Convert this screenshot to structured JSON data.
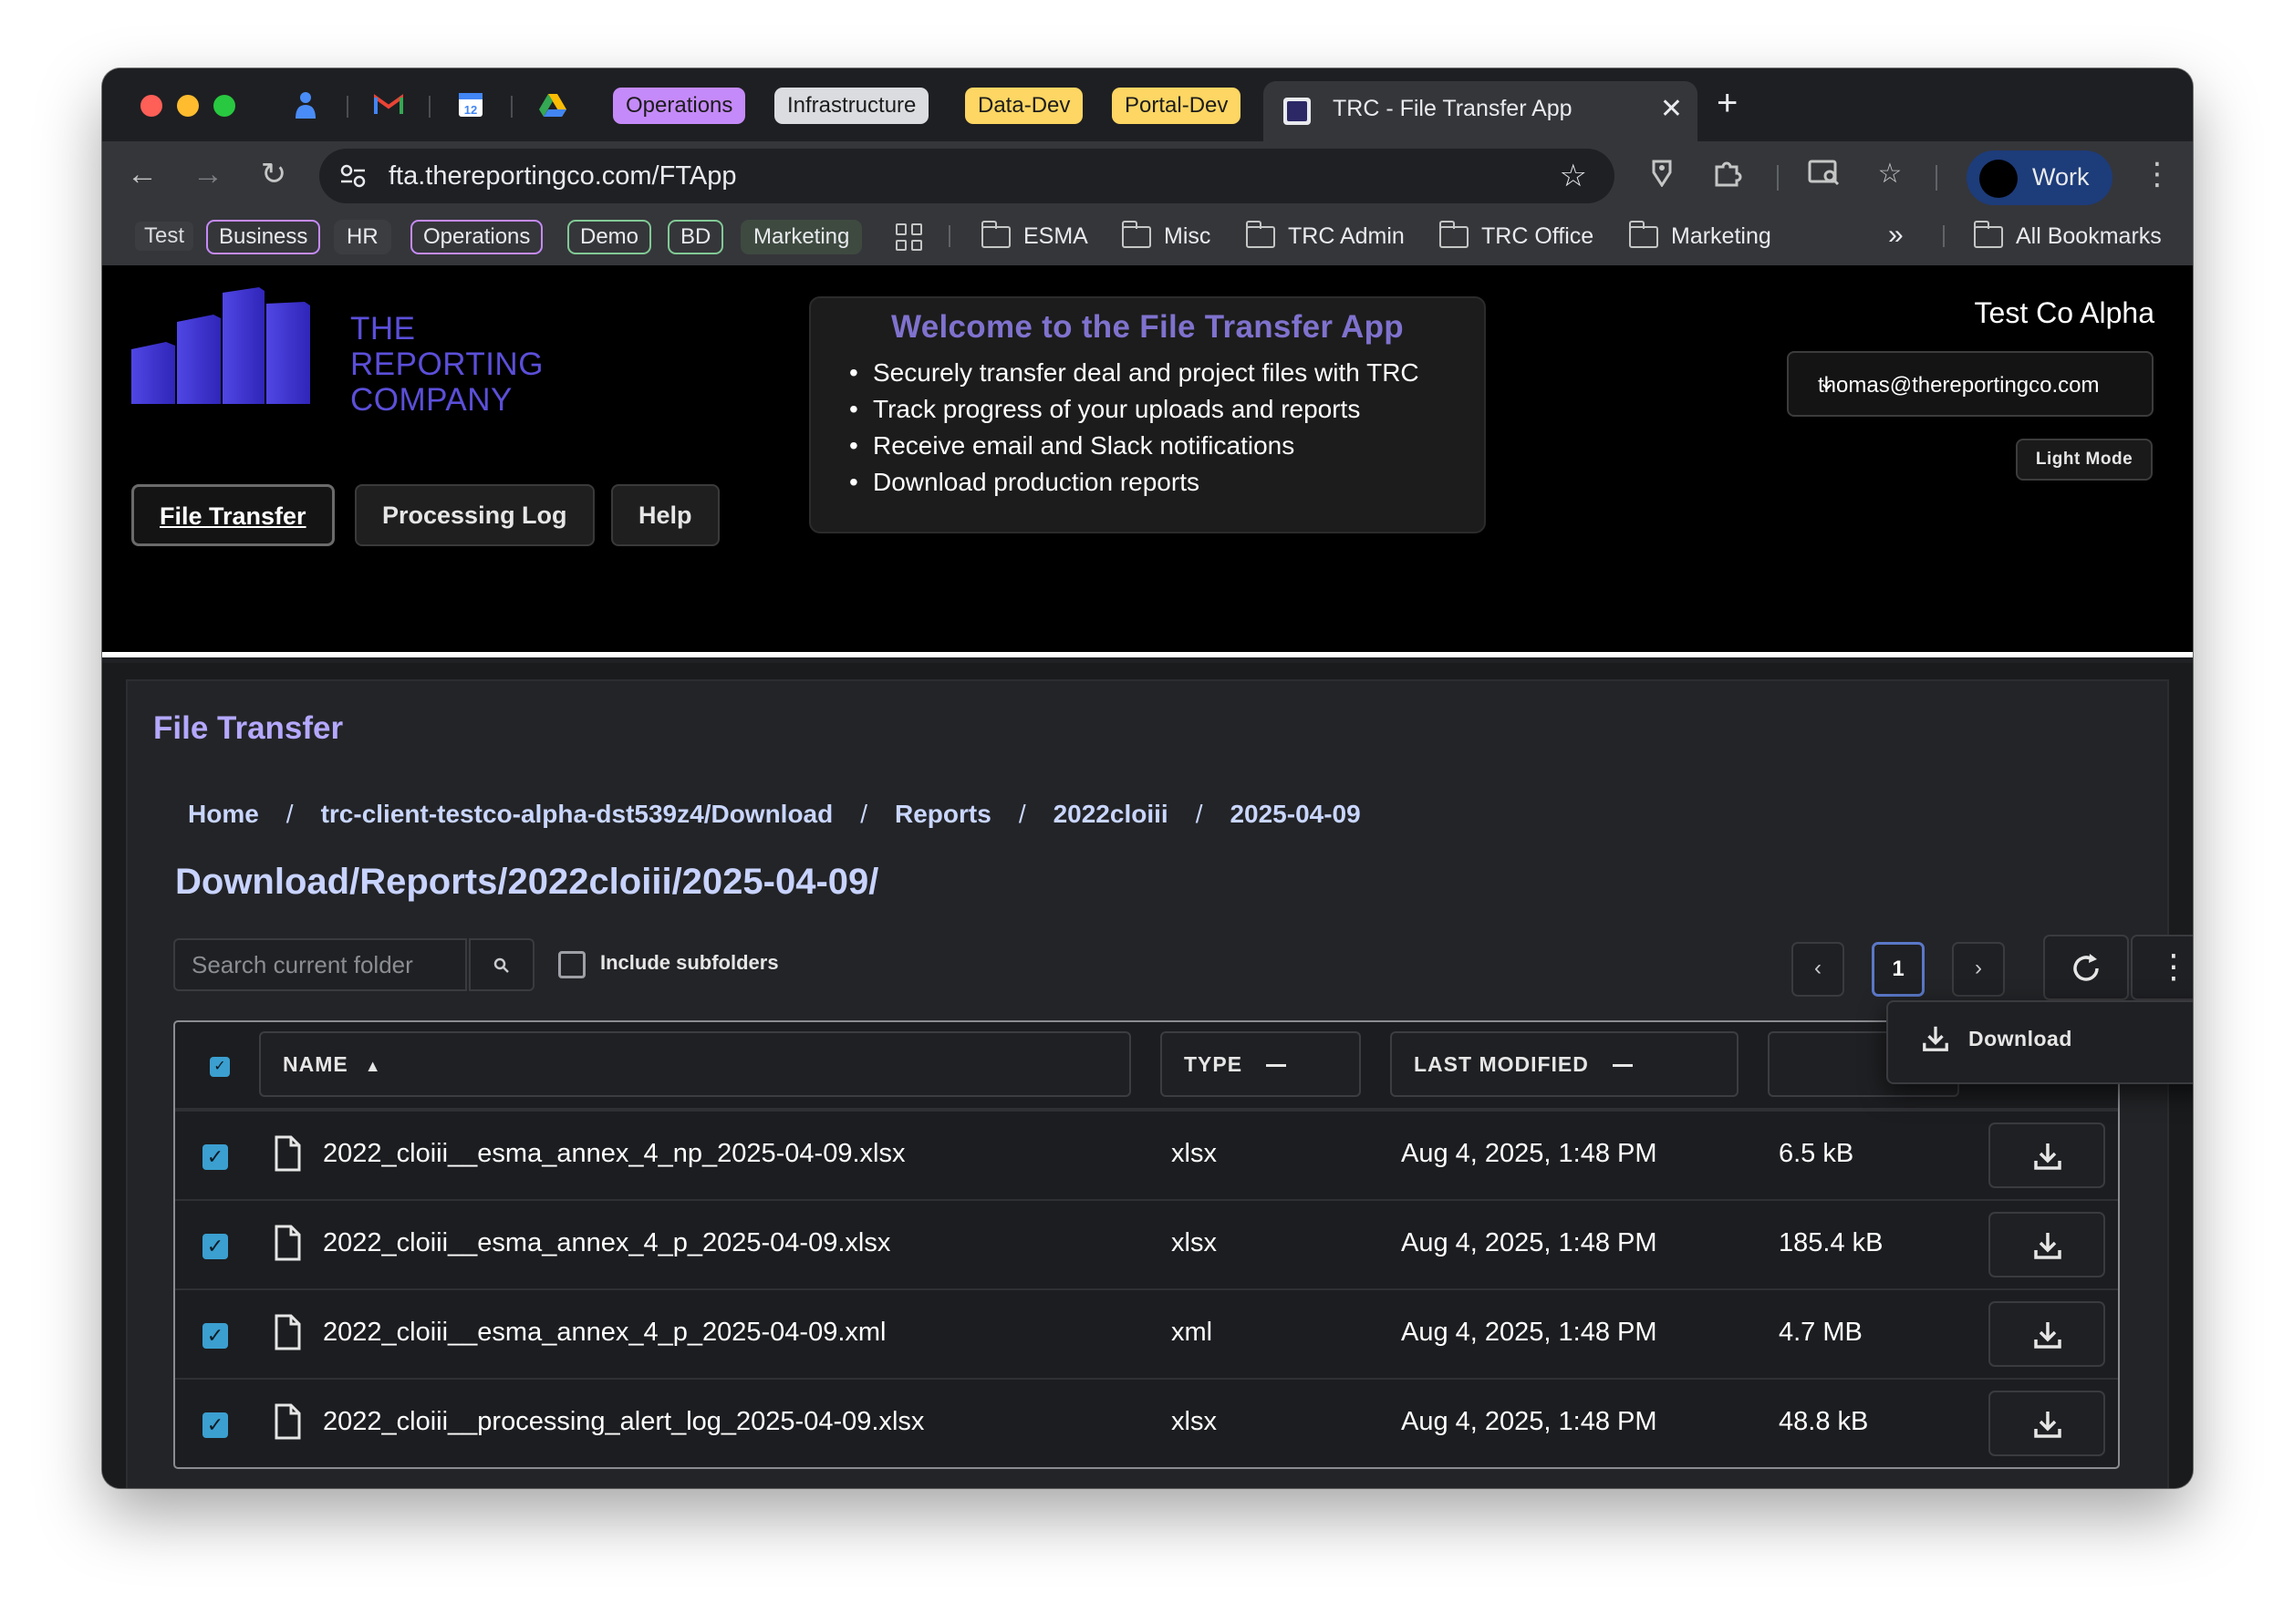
{
  "browser": {
    "tab_groups": [
      {
        "label": "Operations",
        "color": "#c58af9"
      },
      {
        "label": "Infrastructure",
        "color": "#dadce0"
      },
      {
        "label": "Data-Dev",
        "color": "#fdd663"
      },
      {
        "label": "Portal-Dev",
        "color": "#fdd663"
      }
    ],
    "active_tab_title": "TRC - File Transfer App",
    "url": "fta.thereportingco.com/FTApp",
    "profile_label": "Work",
    "bookmark_chips": [
      {
        "label": "Test",
        "color": "#dadce0"
      },
      {
        "label": "Business",
        "color": "#c58af9"
      },
      {
        "label": "HR",
        "color": "#f28b82"
      },
      {
        "label": "Operations",
        "color": "#c58af9"
      },
      {
        "label": "Demo",
        "color": "#81c995"
      },
      {
        "label": "BD",
        "color": "#81c995"
      },
      {
        "label": "Marketing",
        "color": "#81c995"
      }
    ],
    "bookmark_folders": [
      "ESMA",
      "Misc",
      "TRC Admin",
      "TRC Office",
      "Marketing"
    ],
    "all_bookmarks_label": "All Bookmarks"
  },
  "app": {
    "logo_text": [
      "THE",
      "REPORTING",
      "COMPANY"
    ],
    "nav": {
      "file_transfer": "File Transfer",
      "processing_log": "Processing Log",
      "help": "Help"
    },
    "welcome": {
      "title": "Welcome to the File Transfer App",
      "bullets": [
        "Securely transfer deal and project files with TRC",
        "Track progress of your uploads and reports",
        "Receive email and Slack notifications",
        "Download production reports"
      ]
    },
    "company_name": "Test Co Alpha",
    "user_email": "thomas@thereportingco.com",
    "light_mode_label": "Light Mode",
    "accent_color": "#5b4fd9"
  },
  "file_transfer": {
    "title": "File Transfer",
    "breadcrumb": [
      "Home",
      "trc-client-testco-alpha-dst539z4/Download",
      "Reports",
      "2022cloiii",
      "2025-04-09"
    ],
    "path_heading": "Download/Reports/2022cloiii/2025-04-09/",
    "search_placeholder": "Search current folder",
    "include_subfolders_label": "Include subfolders",
    "page_current": "1",
    "columns": {
      "name": "NAME",
      "type": "TYPE",
      "last_modified": "LAST MODIFIED"
    },
    "rows": [
      {
        "name": "2022_cloiii__esma_annex_4_np_2025-04-09.xlsx",
        "type": "xlsx",
        "modified": "Aug 4, 2025, 1:48 PM",
        "size": "6.5 kB",
        "checked": true
      },
      {
        "name": "2022_cloiii__esma_annex_4_p_2025-04-09.xlsx",
        "type": "xlsx",
        "modified": "Aug 4, 2025, 1:48 PM",
        "size": "185.4 kB",
        "checked": true
      },
      {
        "name": "2022_cloiii__esma_annex_4_p_2025-04-09.xml",
        "type": "xml",
        "modified": "Aug 4, 2025, 1:48 PM",
        "size": "4.7 MB",
        "checked": true
      },
      {
        "name": "2022_cloiii__processing_alert_log_2025-04-09.xlsx",
        "type": "xlsx",
        "modified": "Aug 4, 2025, 1:48 PM",
        "size": "48.8 kB",
        "checked": true
      }
    ],
    "dropdown_item": "Download"
  }
}
